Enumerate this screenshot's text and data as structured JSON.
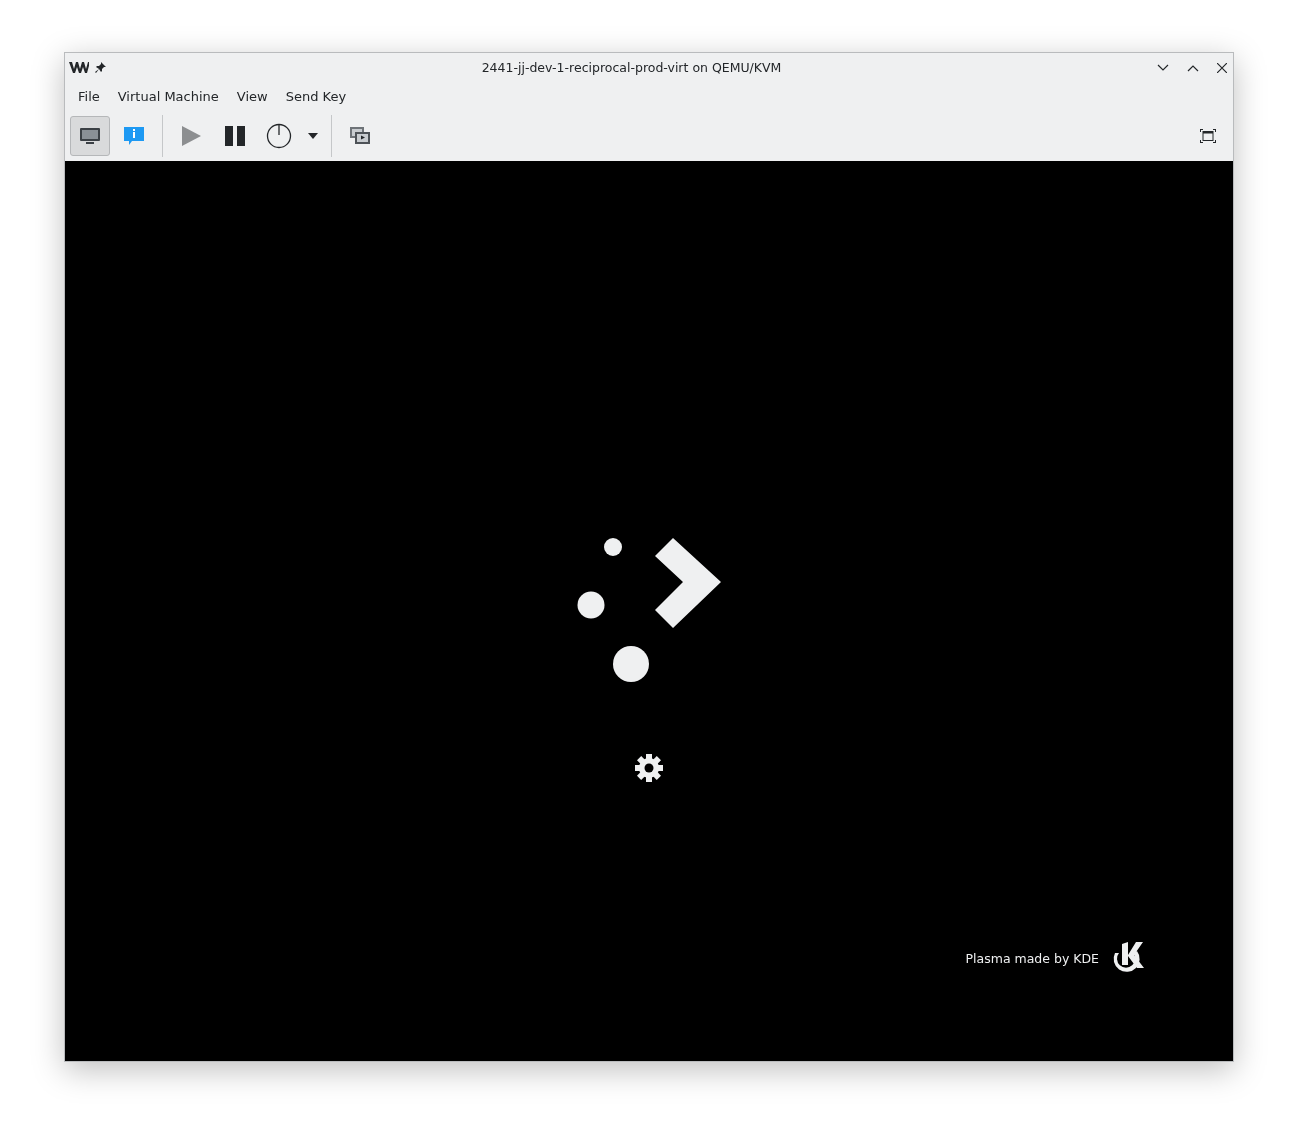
{
  "window": {
    "title": "2441-jj-dev-1-reciprocal-prod-virt on QEMU/KVM"
  },
  "menu": [
    "File",
    "Virtual Machine",
    "View",
    "Send Key"
  ],
  "toolbar_groups": [
    {
      "buttons": [
        {
          "kind": "console",
          "selected": true
        },
        {
          "kind": "details",
          "selected": false
        }
      ]
    },
    {
      "buttons": [
        {
          "kind": "run",
          "selected": false,
          "disabled": true
        },
        {
          "kind": "pause",
          "selected": false,
          "disabled": false
        },
        {
          "kind": "power",
          "selected": false,
          "disabled": false
        },
        {
          "kind": "dropdown",
          "selected": false
        }
      ]
    },
    {
      "buttons": [
        {
          "kind": "snapshots",
          "selected": false
        }
      ]
    }
  ],
  "screen": {
    "footer": "Plasma made by KDE"
  }
}
